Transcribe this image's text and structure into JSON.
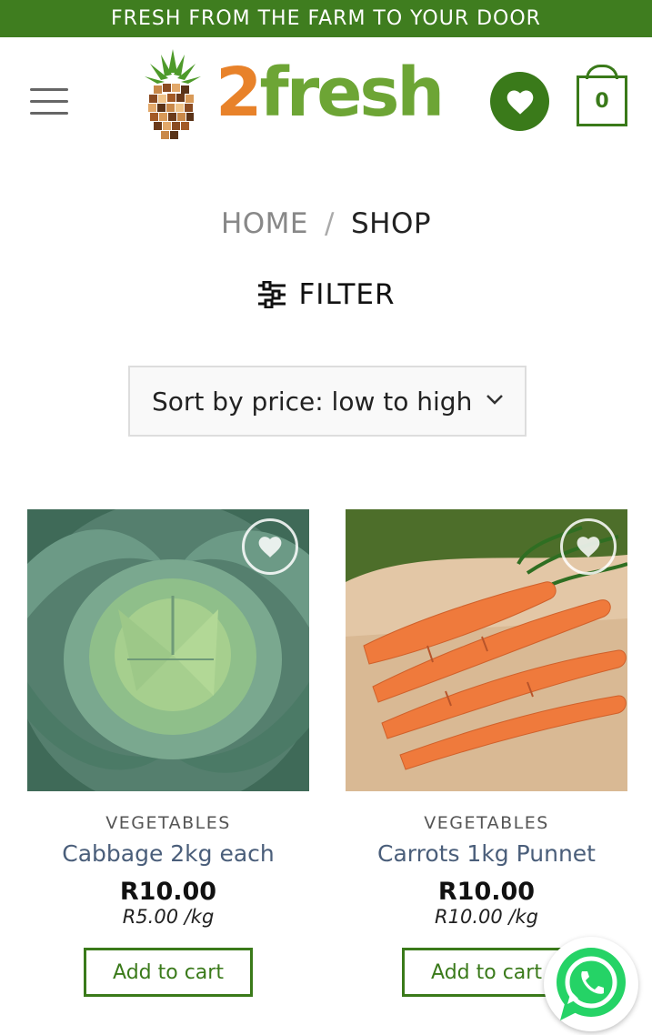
{
  "promo": {
    "text": "FRESH FROM THE FARM TO YOUR DOOR"
  },
  "header": {
    "logo_digit": "2",
    "logo_word": "fresh",
    "cart_count": "0"
  },
  "breadcrumb": {
    "home": "HOME",
    "separator": "/",
    "current": "SHOP"
  },
  "filter": {
    "label": "FILTER"
  },
  "sort": {
    "selected": "Sort by price: low to high"
  },
  "products": [
    {
      "category": "VEGETABLES",
      "name": "Cabbage 2kg each",
      "price": "R10.00",
      "unit_price": "R5.00 /kg",
      "button": "Add to cart"
    },
    {
      "category": "VEGETABLES",
      "name": "Carrots 1kg Punnet",
      "price": "R10.00",
      "unit_price": "R10.00 /kg",
      "button": "Add to cart"
    }
  ],
  "colors": {
    "brand_green": "#3a7a1a",
    "logo_orange": "#e8822a",
    "logo_green": "#6da535",
    "whatsapp": "#25d366"
  },
  "icons": [
    "menu-icon",
    "heart-icon",
    "cart-icon",
    "filter-icon",
    "chevron-down-icon",
    "whatsapp-icon"
  ]
}
